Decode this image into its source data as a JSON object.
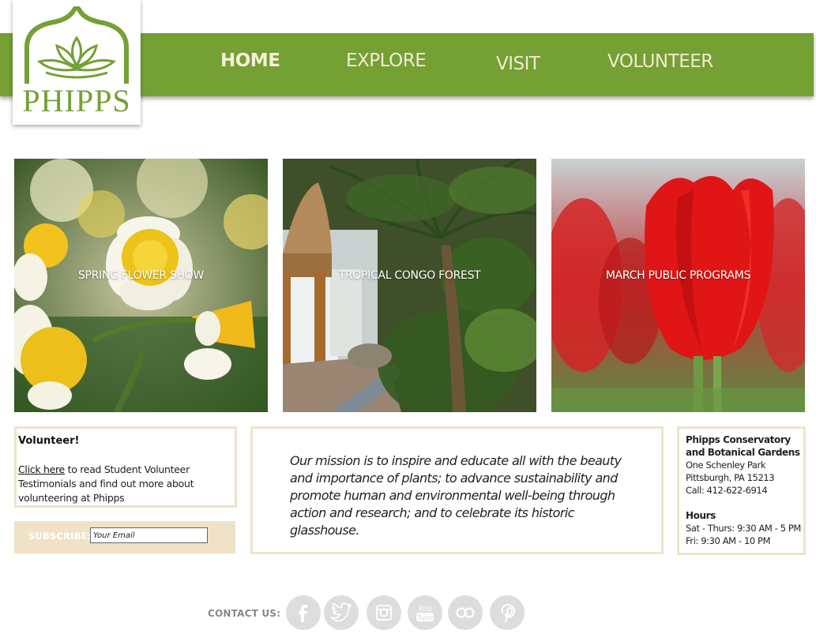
{
  "brand": {
    "name": "PHIPPS",
    "color": "#74a034"
  },
  "nav": {
    "items": [
      {
        "label": "HOME",
        "active": true
      },
      {
        "label": "EXPLORE"
      },
      {
        "label": "VISIT"
      },
      {
        "label": "VOLUNTEER"
      }
    ]
  },
  "tiles": [
    {
      "label": "SPRING FLOWER SHOW"
    },
    {
      "label": "TROPICAL CONGO FOREST"
    },
    {
      "label": "MARCH PUBLIC PROGRAMS"
    }
  ],
  "volunteer": {
    "title": "Volunteer!",
    "link_text": "Click here",
    "text": " to read Student Volunteer Testimonials and find out more about volunteering at Phipps"
  },
  "subscribe": {
    "label": "SUBSCRIBE:",
    "placeholder": "Your Email"
  },
  "mission": {
    "text": "Our mission is to inspire and educate all with the beauty and importance of plants; to advance sustainability and promote human and environmental well-being through action and research; and to celebrate its historic glasshouse."
  },
  "info": {
    "name": "Phipps Conservatory and Botanical Gardens",
    "address1": "One Schenley Park",
    "address2": "Pittsburgh, PA 15213",
    "phone": "Call:  412-622-6914",
    "hours_title": "Hours",
    "hours1": "Sat - Thurs: 9:30 AM - 5 PM",
    "hours2": "Fri: 9:30 AM - 10 PM"
  },
  "contact": {
    "label": "CONTACT US:",
    "icons": [
      "facebook-icon",
      "twitter-icon",
      "instagram-icon",
      "youtube-icon",
      "flickr-icon",
      "pinterest-icon"
    ]
  }
}
